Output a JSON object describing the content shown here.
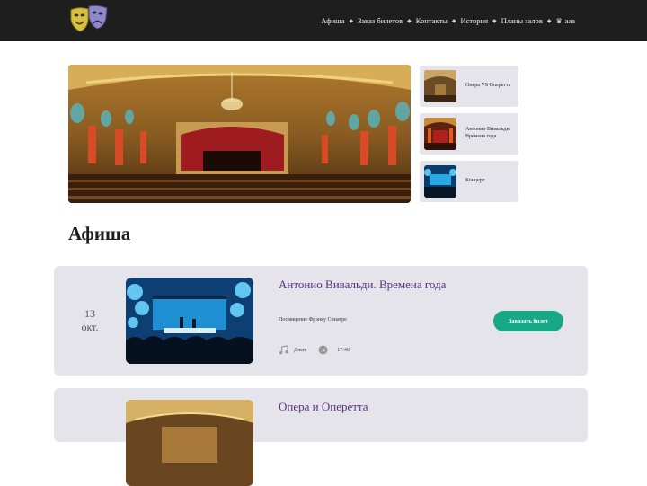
{
  "header": {
    "nav": [
      {
        "label": "Афиша"
      },
      {
        "label": "Заказ билетов"
      },
      {
        "label": "Контакты"
      },
      {
        "label": "История"
      },
      {
        "label": "Планы залов"
      }
    ],
    "user": {
      "icon": "crown-icon",
      "name": "ааа"
    },
    "logo": {
      "icon": "theatre-masks-icon"
    }
  },
  "hero": {
    "image": "theater-interior-photo"
  },
  "slides": [
    {
      "label": "Опера VS Оперетта"
    },
    {
      "label": "Антонио Вивальди. Времена года"
    },
    {
      "label": "Концерт"
    }
  ],
  "section_title": "Афиша",
  "events": [
    {
      "day": "13",
      "month": "окт.",
      "title": "Антонио Вивальди. Времена года",
      "description": "Посвящение Фрэнку Синатре",
      "genre": "Джаз",
      "time": "17:48",
      "button": "Заказать билет",
      "colors": {
        "accent": "#17a986",
        "title": "#5b2d86"
      }
    },
    {
      "title": "Опера и Оперетта"
    }
  ]
}
